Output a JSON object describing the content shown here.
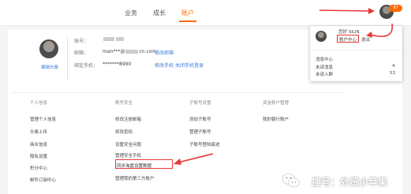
{
  "nav": {
    "items": [
      "业务",
      "成长",
      "账户"
    ],
    "badge": "87"
  },
  "profile": {
    "edit_avatar": "编辑头像",
    "account_label": "账号：",
    "email_label": "邮箱：",
    "email_value": "man***@",
    "email_suffix": "cn.com",
    "edit_email": "修改邮箱",
    "phone_label": "绑定手机：",
    "phone_value": "*******8990",
    "edit_phone": "修改手机",
    "close_phone_login": "关闭手机登录"
  },
  "columns": [
    {
      "header": "个人信息",
      "items": [
        "管理个人信息",
        "头像上传",
        "商业信息",
        "隐私设置",
        "积分中心",
        "邮件订阅中心"
      ]
    },
    {
      "header": "账号安全",
      "items": [
        "修改注册邮箱",
        "修改密码",
        "设置安全问题",
        "管理安全手机",
        "同步淘盘设置数据",
        "管理我的第三方账户"
      ]
    },
    {
      "header": "子账号设置",
      "items": [
        "添加子账号",
        "管理子账号",
        "子账号登陆痕迹"
      ]
    },
    {
      "header": "资金账户管理",
      "items": [
        "我的银行账户"
      ]
    }
  ],
  "dropdown": {
    "greeting": "您好 SILIN",
    "account_center": "账户中心",
    "logout": "退出",
    "messages_title": "消息中心",
    "unread_msgs_label": "未读消息",
    "unread_msgs_count": "4",
    "unread_reqs_label": "未读入群",
    "unread_reqs_count": "53"
  },
  "watermark": {
    "text": "搜号：外贸小苹果"
  },
  "colors": {
    "accent": "#ff6a00",
    "link": "#3b7dd8",
    "annotation": "#e53935"
  }
}
